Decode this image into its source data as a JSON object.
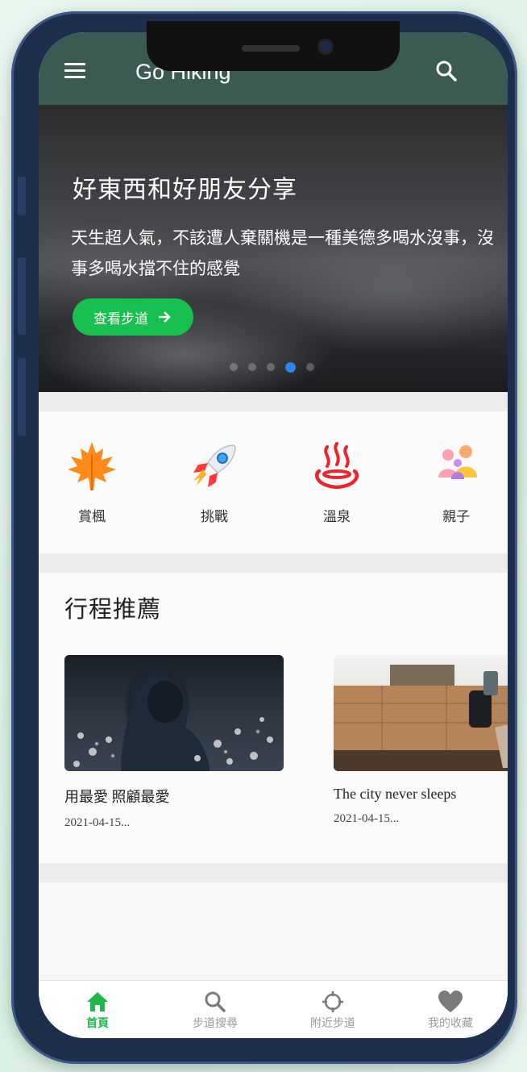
{
  "app": {
    "title": "Go Hiking"
  },
  "hero": {
    "title": "好東西和好朋友分享",
    "text": "天生超人氣，不該遭人棄關機是一種美德多喝水沒事，沒事多喝水擋不住的感覺",
    "button_label": "查看步道",
    "slide_count": 5,
    "active_slide": 4
  },
  "categories": [
    {
      "label": "賞楓",
      "icon": "maple-leaf-icon"
    },
    {
      "label": "挑戰",
      "icon": "rocket-icon"
    },
    {
      "label": "溫泉",
      "icon": "hot-spring-icon"
    },
    {
      "label": "親子",
      "icon": "family-icon"
    }
  ],
  "recommend": {
    "title": "行程推薦",
    "items": [
      {
        "name": "用最愛 照顧最愛",
        "date": "2021-04-15..."
      },
      {
        "name": "The city never sleeps",
        "date": "2021-04-15..."
      }
    ]
  },
  "bottom_nav": [
    {
      "label": "首頁",
      "icon": "home-icon",
      "active": true
    },
    {
      "label": "步道搜尋",
      "icon": "search-icon",
      "active": false
    },
    {
      "label": "附近步道",
      "icon": "location-crosshair-icon",
      "active": false
    },
    {
      "label": "我的收藏",
      "icon": "heart-icon",
      "active": false
    }
  ],
  "colors": {
    "accent": "#1fb84c",
    "appbar": "#3b5b52",
    "phone_frame": "#1e2f4d",
    "active_dot": "#2f86e8"
  }
}
